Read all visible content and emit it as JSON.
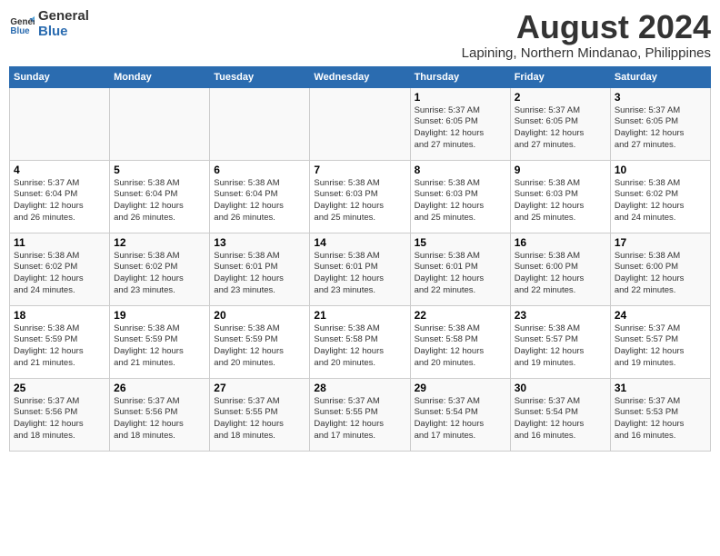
{
  "header": {
    "logo_line1": "General",
    "logo_line2": "Blue",
    "month_year": "August 2024",
    "location": "Lapining, Northern Mindanao, Philippines"
  },
  "days_of_week": [
    "Sunday",
    "Monday",
    "Tuesday",
    "Wednesday",
    "Thursday",
    "Friday",
    "Saturday"
  ],
  "weeks": [
    [
      {
        "day": "",
        "info": ""
      },
      {
        "day": "",
        "info": ""
      },
      {
        "day": "",
        "info": ""
      },
      {
        "day": "",
        "info": ""
      },
      {
        "day": "1",
        "info": "Sunrise: 5:37 AM\nSunset: 6:05 PM\nDaylight: 12 hours\nand 27 minutes."
      },
      {
        "day": "2",
        "info": "Sunrise: 5:37 AM\nSunset: 6:05 PM\nDaylight: 12 hours\nand 27 minutes."
      },
      {
        "day": "3",
        "info": "Sunrise: 5:37 AM\nSunset: 6:05 PM\nDaylight: 12 hours\nand 27 minutes."
      }
    ],
    [
      {
        "day": "4",
        "info": "Sunrise: 5:37 AM\nSunset: 6:04 PM\nDaylight: 12 hours\nand 26 minutes."
      },
      {
        "day": "5",
        "info": "Sunrise: 5:38 AM\nSunset: 6:04 PM\nDaylight: 12 hours\nand 26 minutes."
      },
      {
        "day": "6",
        "info": "Sunrise: 5:38 AM\nSunset: 6:04 PM\nDaylight: 12 hours\nand 26 minutes."
      },
      {
        "day": "7",
        "info": "Sunrise: 5:38 AM\nSunset: 6:03 PM\nDaylight: 12 hours\nand 25 minutes."
      },
      {
        "day": "8",
        "info": "Sunrise: 5:38 AM\nSunset: 6:03 PM\nDaylight: 12 hours\nand 25 minutes."
      },
      {
        "day": "9",
        "info": "Sunrise: 5:38 AM\nSunset: 6:03 PM\nDaylight: 12 hours\nand 25 minutes."
      },
      {
        "day": "10",
        "info": "Sunrise: 5:38 AM\nSunset: 6:02 PM\nDaylight: 12 hours\nand 24 minutes."
      }
    ],
    [
      {
        "day": "11",
        "info": "Sunrise: 5:38 AM\nSunset: 6:02 PM\nDaylight: 12 hours\nand 24 minutes."
      },
      {
        "day": "12",
        "info": "Sunrise: 5:38 AM\nSunset: 6:02 PM\nDaylight: 12 hours\nand 23 minutes."
      },
      {
        "day": "13",
        "info": "Sunrise: 5:38 AM\nSunset: 6:01 PM\nDaylight: 12 hours\nand 23 minutes."
      },
      {
        "day": "14",
        "info": "Sunrise: 5:38 AM\nSunset: 6:01 PM\nDaylight: 12 hours\nand 23 minutes."
      },
      {
        "day": "15",
        "info": "Sunrise: 5:38 AM\nSunset: 6:01 PM\nDaylight: 12 hours\nand 22 minutes."
      },
      {
        "day": "16",
        "info": "Sunrise: 5:38 AM\nSunset: 6:00 PM\nDaylight: 12 hours\nand 22 minutes."
      },
      {
        "day": "17",
        "info": "Sunrise: 5:38 AM\nSunset: 6:00 PM\nDaylight: 12 hours\nand 22 minutes."
      }
    ],
    [
      {
        "day": "18",
        "info": "Sunrise: 5:38 AM\nSunset: 5:59 PM\nDaylight: 12 hours\nand 21 minutes."
      },
      {
        "day": "19",
        "info": "Sunrise: 5:38 AM\nSunset: 5:59 PM\nDaylight: 12 hours\nand 21 minutes."
      },
      {
        "day": "20",
        "info": "Sunrise: 5:38 AM\nSunset: 5:59 PM\nDaylight: 12 hours\nand 20 minutes."
      },
      {
        "day": "21",
        "info": "Sunrise: 5:38 AM\nSunset: 5:58 PM\nDaylight: 12 hours\nand 20 minutes."
      },
      {
        "day": "22",
        "info": "Sunrise: 5:38 AM\nSunset: 5:58 PM\nDaylight: 12 hours\nand 20 minutes."
      },
      {
        "day": "23",
        "info": "Sunrise: 5:38 AM\nSunset: 5:57 PM\nDaylight: 12 hours\nand 19 minutes."
      },
      {
        "day": "24",
        "info": "Sunrise: 5:37 AM\nSunset: 5:57 PM\nDaylight: 12 hours\nand 19 minutes."
      }
    ],
    [
      {
        "day": "25",
        "info": "Sunrise: 5:37 AM\nSunset: 5:56 PM\nDaylight: 12 hours\nand 18 minutes."
      },
      {
        "day": "26",
        "info": "Sunrise: 5:37 AM\nSunset: 5:56 PM\nDaylight: 12 hours\nand 18 minutes."
      },
      {
        "day": "27",
        "info": "Sunrise: 5:37 AM\nSunset: 5:55 PM\nDaylight: 12 hours\nand 18 minutes."
      },
      {
        "day": "28",
        "info": "Sunrise: 5:37 AM\nSunset: 5:55 PM\nDaylight: 12 hours\nand 17 minutes."
      },
      {
        "day": "29",
        "info": "Sunrise: 5:37 AM\nSunset: 5:54 PM\nDaylight: 12 hours\nand 17 minutes."
      },
      {
        "day": "30",
        "info": "Sunrise: 5:37 AM\nSunset: 5:54 PM\nDaylight: 12 hours\nand 16 minutes."
      },
      {
        "day": "31",
        "info": "Sunrise: 5:37 AM\nSunset: 5:53 PM\nDaylight: 12 hours\nand 16 minutes."
      }
    ]
  ]
}
